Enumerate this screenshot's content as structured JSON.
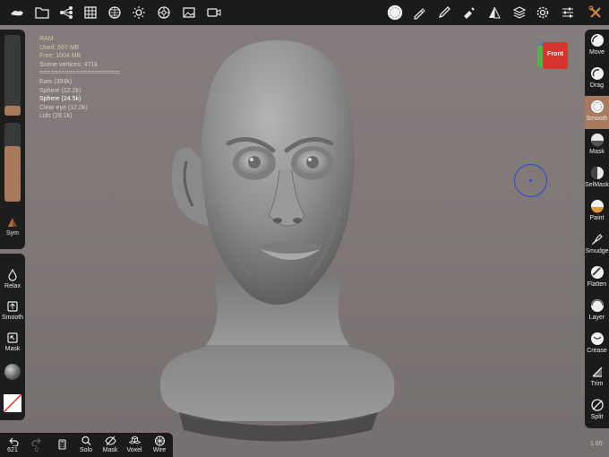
{
  "app": {
    "version": "1.65"
  },
  "stats": {
    "ram_label": "RAM",
    "used": "Used: 667 MB",
    "free": "Free: 1004 MB",
    "scene_vertices": "Scene vertices: 471k",
    "separator": "======================",
    "objects": [
      {
        "label": "Ears (393k)",
        "selected": false
      },
      {
        "label": "Sphere (12.2k)",
        "selected": false
      },
      {
        "label": "Sphere (24.5k)",
        "selected": true
      },
      {
        "label": "Clear eye (12.2k)",
        "selected": false
      },
      {
        "label": "Lids (29.1k)",
        "selected": false
      }
    ]
  },
  "left_panel": {
    "radius_level": 0.12,
    "intensity_level": 0.7,
    "sym_label": "Sym",
    "relax_label": "Relax",
    "smooth_label": "Smooth",
    "mask_label": "Mask"
  },
  "bottom_bar": {
    "undo_count": "621",
    "redo_count": "0",
    "solo_label": "Solo",
    "mask_label": "Mask",
    "voxel_label": "Voxel",
    "wire_label": "Wire"
  },
  "right_tools": [
    {
      "label": "Move",
      "icon": "move-icon",
      "active": false
    },
    {
      "label": "Drag",
      "icon": "drag-icon",
      "active": false
    },
    {
      "label": "Smooth",
      "icon": "smooth-icon",
      "active": true
    },
    {
      "label": "Mask",
      "icon": "mask-icon",
      "active": false
    },
    {
      "label": "SelMask",
      "icon": "selmask-icon",
      "active": false
    },
    {
      "label": "Paint",
      "icon": "paint-icon",
      "active": false
    },
    {
      "label": "Smudge",
      "icon": "smudge-icon",
      "active": false
    },
    {
      "label": "Flatten",
      "icon": "flatten-icon",
      "active": false
    },
    {
      "label": "Layer",
      "icon": "layer-icon",
      "active": false
    },
    {
      "label": "Crease",
      "icon": "crease-icon",
      "active": false
    },
    {
      "label": "Trim",
      "icon": "trim-icon",
      "active": false
    },
    {
      "label": "Split",
      "icon": "split-icon",
      "active": false
    }
  ],
  "view_cube": {
    "face_label": "Front"
  },
  "colors": {
    "accent": "#a77a5e",
    "toolbar": "#1b1b1b",
    "cube_front": "#d6352b",
    "cube_side": "#4fb14a",
    "cube_top": "#3e7fd1",
    "cursor": "#2a49d6"
  }
}
